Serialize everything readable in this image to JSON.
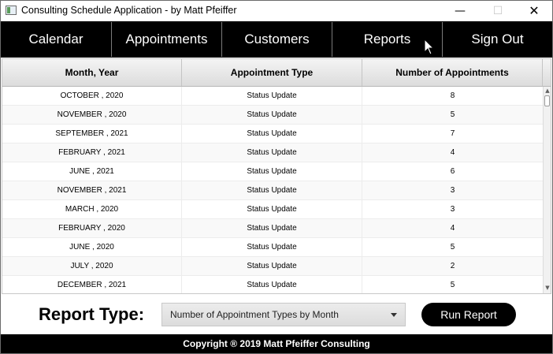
{
  "window": {
    "title": "Consulting Schedule Application - by Matt Pfeiffer",
    "minimize_glyph": "—",
    "maximize_glyph": "☐",
    "close_glyph": "✕"
  },
  "nav": {
    "items": [
      {
        "label": "Calendar"
      },
      {
        "label": "Appointments"
      },
      {
        "label": "Customers"
      },
      {
        "label": "Reports"
      },
      {
        "label": "Sign Out"
      }
    ]
  },
  "table": {
    "columns": [
      "Month, Year",
      "Appointment Type",
      "Number of Appointments"
    ],
    "rows": [
      {
        "month_year": "OCTOBER , 2020",
        "type": "Status Update",
        "count": "8"
      },
      {
        "month_year": "NOVEMBER , 2020",
        "type": "Status Update",
        "count": "5"
      },
      {
        "month_year": "SEPTEMBER , 2021",
        "type": "Status Update",
        "count": "7"
      },
      {
        "month_year": "FEBRUARY , 2021",
        "type": "Status Update",
        "count": "4"
      },
      {
        "month_year": "JUNE , 2021",
        "type": "Status Update",
        "count": "6"
      },
      {
        "month_year": "NOVEMBER , 2021",
        "type": "Status Update",
        "count": "3"
      },
      {
        "month_year": "MARCH , 2020",
        "type": "Status Update",
        "count": "3"
      },
      {
        "month_year": "FEBRUARY , 2020",
        "type": "Status Update",
        "count": "4"
      },
      {
        "month_year": "JUNE , 2020",
        "type": "Status Update",
        "count": "5"
      },
      {
        "month_year": "JULY , 2020",
        "type": "Status Update",
        "count": "2"
      },
      {
        "month_year": "DECEMBER , 2021",
        "type": "Status Update",
        "count": "5"
      }
    ]
  },
  "report": {
    "label": "Report Type:",
    "selected": "Number of Appointment Types by Month",
    "run_label": "Run Report"
  },
  "footer": {
    "copyright": "Copyright ® 2019 Matt Pfeiffer Consulting"
  },
  "colors": {
    "nav_background": "#000000",
    "nav_text": "#ffffff",
    "run_button": "#000000",
    "footer_background": "#000000"
  }
}
